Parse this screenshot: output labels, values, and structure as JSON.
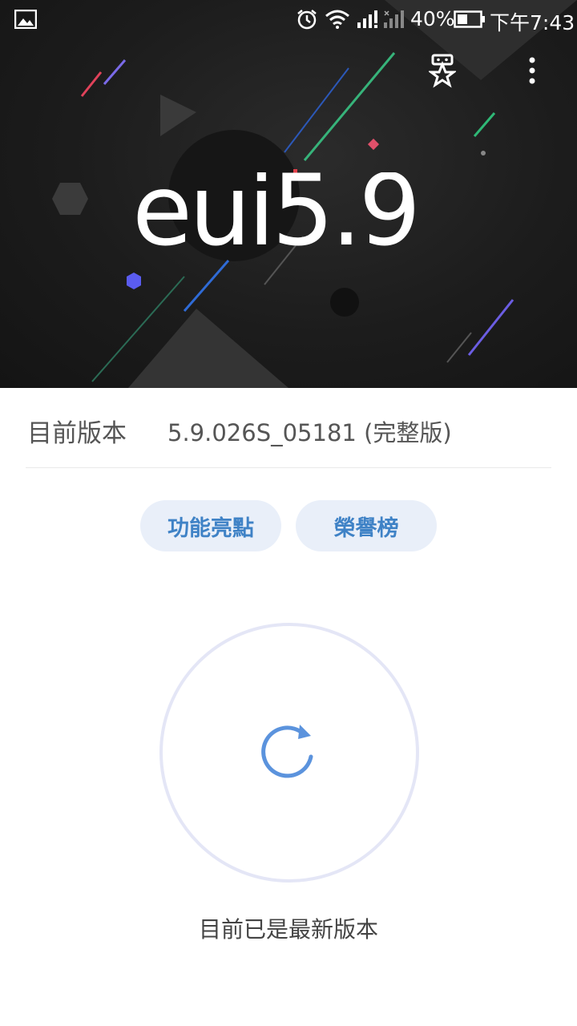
{
  "status_bar": {
    "battery_percent": "40%",
    "time": "下午7:43",
    "icons": [
      "image-notification-icon",
      "alarm-icon",
      "wifi-icon",
      "signal-icon",
      "signal-empty-icon",
      "battery-icon"
    ]
  },
  "hero": {
    "logo_text": "eui5.9",
    "icons": [
      "honor-badge-icon",
      "more-vert-icon"
    ]
  },
  "version": {
    "label": "目前版本",
    "value": "5.9.026S_05181 (完整版)"
  },
  "buttons": {
    "features": "功能亮點",
    "honor_list": "榮譽榜"
  },
  "update": {
    "message": "目前已是最新版本",
    "icon": "refresh-icon"
  },
  "colors": {
    "accent": "#3f82c6",
    "pill_bg": "#e9eff9",
    "ring": "#e4e6f6",
    "refresh": "#5b93dd"
  }
}
